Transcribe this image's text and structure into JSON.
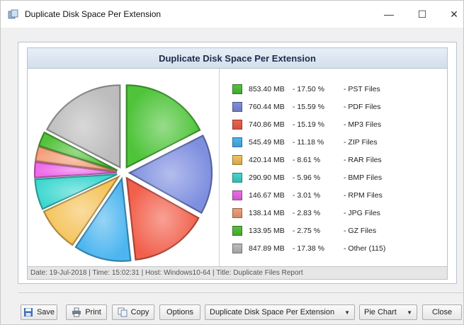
{
  "window": {
    "title": "Duplicate Disk Space Per Extension",
    "controls": {
      "minimize": "—",
      "maximize": "☐",
      "close": "✕"
    }
  },
  "report": {
    "header": "Duplicate Disk Space Per Extension",
    "footer": "Date: 19-Jul-2018 | Time: 15:02:31 | Host: Windows10-64 | Title: Duplicate Files Report"
  },
  "chart_data": {
    "type": "pie",
    "title": "Duplicate Disk Space Per Extension",
    "slices": [
      {
        "size": "853.40 MB",
        "percent": "17.50 %",
        "label": "PST Files",
        "value": 17.5,
        "color": "#4fc43a"
      },
      {
        "size": "760.44 MB",
        "percent": "15.59 %",
        "label": "PDF Files",
        "value": 15.59,
        "color": "#7f8fe0"
      },
      {
        "size": "740.86 MB",
        "percent": "15.19 %",
        "label": "MP3 Files",
        "value": 15.19,
        "color": "#f2604c"
      },
      {
        "size": "545.49 MB",
        "percent": "11.18 %",
        "label": "ZIP Files",
        "value": 11.18,
        "color": "#4db6f0"
      },
      {
        "size": "420.14 MB",
        "percent": "8.61 %",
        "label": "RAR Files",
        "value": 8.61,
        "color": "#f5c35a"
      },
      {
        "size": "290.90 MB",
        "percent": "5.96 %",
        "label": "BMP Files",
        "value": 5.96,
        "color": "#3fd8d0"
      },
      {
        "size": "146.67 MB",
        "percent": "3.01 %",
        "label": "RPM Files",
        "value": 3.01,
        "color": "#ee6bea"
      },
      {
        "size": "138.14 MB",
        "percent": "2.83 %",
        "label": "JPG Files",
        "value": 2.83,
        "color": "#f3a07a"
      },
      {
        "size": "133.95 MB",
        "percent": "2.75 %",
        "label": "GZ Files",
        "value": 2.75,
        "color": "#54c23a"
      },
      {
        "size": "847.89 MB",
        "percent": "17.38 %",
        "label": "Other (115)",
        "value": 17.38,
        "color": "#bdbdbd"
      }
    ]
  },
  "toolbar": {
    "save_label": "Save",
    "print_label": "Print",
    "copy_label": "Copy",
    "options_label": "Options",
    "report_select": "Duplicate Disk Space Per Extension",
    "chart_type_select": "Pie Chart",
    "close_label": "Close"
  }
}
